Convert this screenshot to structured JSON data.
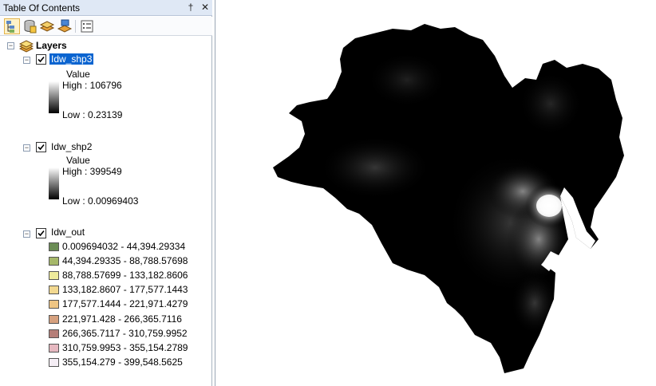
{
  "toc": {
    "title": "Table Of Contents",
    "pin_glyph": "†",
    "close_glyph": "✕",
    "toolbar": [
      {
        "name": "list-by-drawing-order-icon"
      },
      {
        "name": "list-by-source-icon"
      },
      {
        "name": "list-by-visibility-icon"
      },
      {
        "name": "list-by-selection-icon"
      },
      {
        "name": "options-icon"
      }
    ],
    "root": {
      "label": "Layers",
      "expander": "−"
    },
    "layers": [
      {
        "name": "Idw_shp3",
        "checked": true,
        "selected": true,
        "legend_title": "Value",
        "high": "High : 106796",
        "low": "Low : 0.23139"
      },
      {
        "name": "Idw_shp2",
        "checked": true,
        "selected": false,
        "legend_title": "Value",
        "high": "High : 399549",
        "low": "Low : 0.00969403"
      },
      {
        "name": "Idw_out",
        "checked": true,
        "selected": false,
        "classes": [
          {
            "label": "0.009694032 - 44,394.29334",
            "color": "#6b8c55"
          },
          {
            "label": "44,394.29335 - 88,788.57698",
            "color": "#a6b86a"
          },
          {
            "label": "88,788.57699 - 133,182.8606",
            "color": "#eeeb9c"
          },
          {
            "label": "133,182.8607 - 177,577.1443",
            "color": "#f2d890"
          },
          {
            "label": "177,577.1444 - 221,971.4279",
            "color": "#efc684"
          },
          {
            "label": "221,971.428 - 266,365.7116",
            "color": "#d6a17f"
          },
          {
            "label": "266,365.7117 - 310,759.9952",
            "color": "#b57e78"
          },
          {
            "label": "310,759.9953 - 355,154.2789",
            "color": "#e6b8c0"
          },
          {
            "label": "355,154.279 - 399,548.5625",
            "color": "#f5eef5"
          }
        ]
      }
    ]
  },
  "colors": {
    "selection": "#0a64d0",
    "map_background": "#ffffff",
    "raster_low": "#000000",
    "raster_high": "#ffffff"
  }
}
